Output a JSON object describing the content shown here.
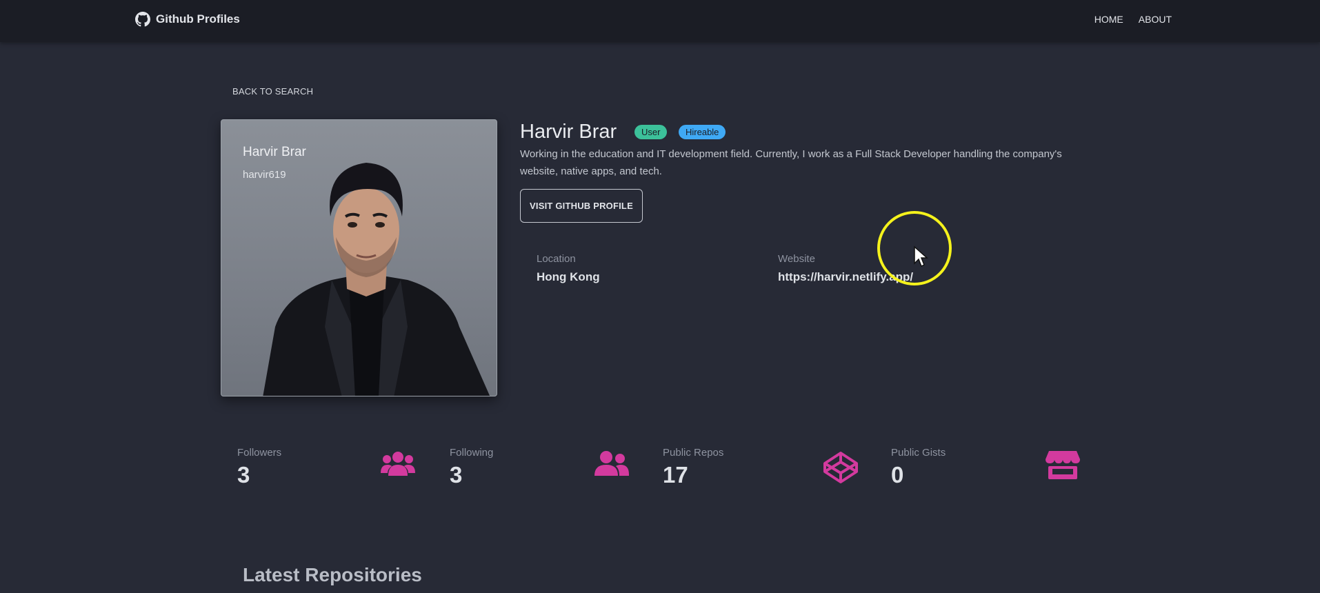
{
  "navbar": {
    "brand": "Github Profiles",
    "links": [
      "HOME",
      "ABOUT"
    ]
  },
  "back_link": "BACK TO SEARCH",
  "card": {
    "name": "Harvir Brar",
    "login": "harvir619"
  },
  "profile": {
    "name": "Harvir Brar",
    "badges": [
      "User",
      "Hireable"
    ],
    "bio": "Working in the education and IT development field. Currently, I work as a Full Stack Developer handling the company's website, native apps, and tech.",
    "visit_button": "VISIT GITHUB PROFILE",
    "location_label": "Location",
    "location": "Hong Kong",
    "website_label": "Website",
    "website": "https://harvir.netlify.app/"
  },
  "stats": [
    {
      "label": "Followers",
      "value": "3",
      "icon": "users-icon"
    },
    {
      "label": "Following",
      "value": "3",
      "icon": "user-friends-icon"
    },
    {
      "label": "Public Repos",
      "value": "17",
      "icon": "codepen-icon"
    },
    {
      "label": "Public Gists",
      "value": "0",
      "icon": "store-icon"
    }
  ],
  "section_title": "Latest Repositories",
  "colors": {
    "background": "#272a36",
    "navbar": "#1b1d25",
    "accent_pink": "#d33a9e",
    "badge_user": "#3cc19a",
    "badge_hireable": "#3fa9f5"
  }
}
